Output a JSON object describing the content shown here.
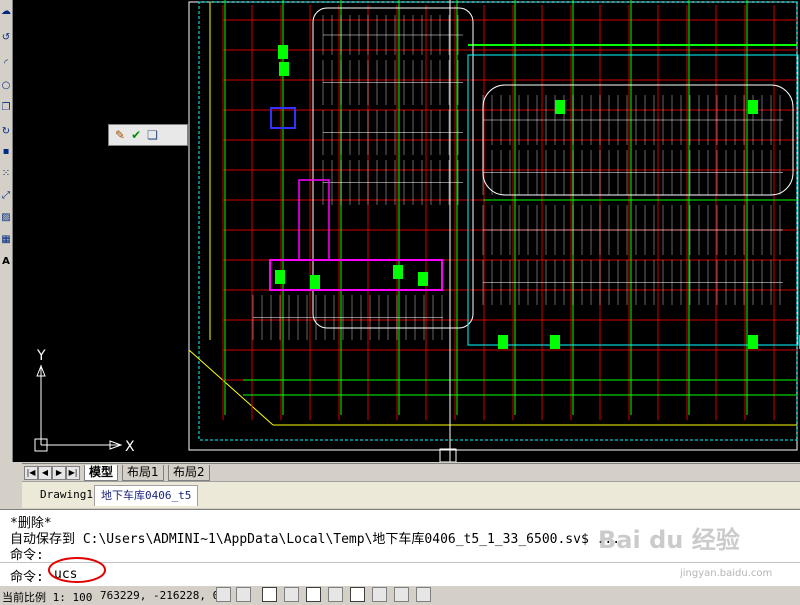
{
  "colors": {
    "canvas": "#000000",
    "grid_red": "#d00000",
    "grid_green": "#00ff00",
    "wall_white": "#ffffff",
    "accent_magenta": "#ff00ff",
    "accent_blue": "#3333ff",
    "accent_yellow": "#ffff00",
    "accent_cyan": "#00ffff",
    "annotation_red": "#e00000"
  },
  "toolbar_left_icons": [
    "revision-cloud-icon",
    "undo-icon",
    "arc-icon",
    "circle-icon",
    "copy-icon",
    "rotate-icon",
    "block-icon",
    "dots-icon",
    "move-icon",
    "hatch-icon",
    "table-icon",
    "text-icon"
  ],
  "float_toolbar": {
    "icons": [
      "edit-icon",
      "check-icon",
      "layer-icon"
    ]
  },
  "ucs": {
    "y_label": "Y",
    "x_label": "X"
  },
  "layout_tabs": [
    "模型",
    "布局1",
    "布局2"
  ],
  "active_layout_tab": "模型",
  "doc_tabs": [
    "Drawing1",
    "地下车库0406_t5"
  ],
  "active_doc_tab": "地下车库0406_t5",
  "command_history": [
    "*删除*",
    "自动保存到 C:\\Users\\ADMINI~1\\AppData\\Local\\Temp\\地下车库0406_t5_1_33_6500.sv$ ...",
    "命令:"
  ],
  "command_prompt": "命令:",
  "command_input_value": "ucs",
  "status": {
    "scale_label": "当前比例 1: 100",
    "coordinates": "763229, -216228, 0",
    "toggle_icons": [
      "snap-icon",
      "grid-icon",
      "ortho-icon",
      "polar-icon",
      "osnap-icon",
      "otrack-icon",
      "ducs-icon",
      "dyn-icon",
      "lineweight-icon",
      "qp-icon",
      "model-icon",
      "annotation-icon",
      "lock-icon"
    ]
  },
  "watermark": "Bai du 经验",
  "watermark_url": "jingyan.baidu.com"
}
